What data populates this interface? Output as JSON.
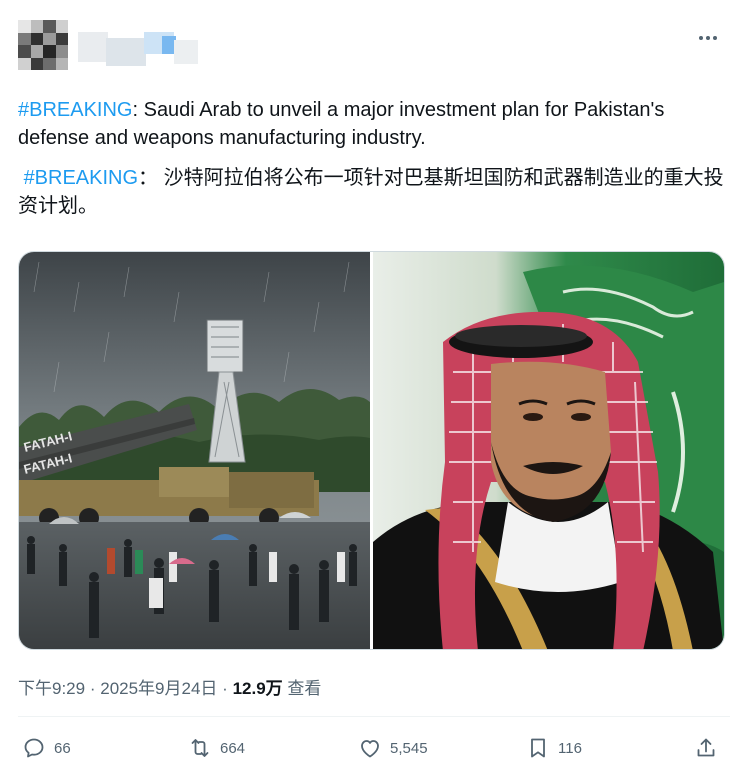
{
  "post": {
    "text_en": {
      "hashtag": "#BREAKING",
      "body": ": Saudi Arab to unveil a major investment plan for Pakistan's defense and weapons manufacturing industry."
    },
    "text_zh": {
      "hashtag": "#BREAKING",
      "body": "： 沙特阿拉伯将公布一项针对巴基斯坦国防和武器制造业的重大投资计划。"
    },
    "images": {
      "left": {
        "icon": "military-parade-photo",
        "banner_text": "FATAH-I"
      },
      "right": {
        "icon": "portrait-photo"
      }
    }
  },
  "meta": {
    "time": "下午9:29",
    "separator": "·",
    "date": "2025年9月24日",
    "views_count": "12.9万",
    "views_label": "查看"
  },
  "actions": {
    "reply": {
      "icon": "reply-icon",
      "count": "66"
    },
    "retweet": {
      "icon": "retweet-icon",
      "count": "664"
    },
    "like": {
      "icon": "heart-icon",
      "count": "5,545"
    },
    "bookmark": {
      "icon": "bookmark-icon",
      "count": "116"
    },
    "share": {
      "icon": "share-icon"
    }
  },
  "colors": {
    "link": "#1d9bf0",
    "secondary_text": "#536471",
    "primary_text": "#0f1419",
    "border": "#cfd9de"
  }
}
